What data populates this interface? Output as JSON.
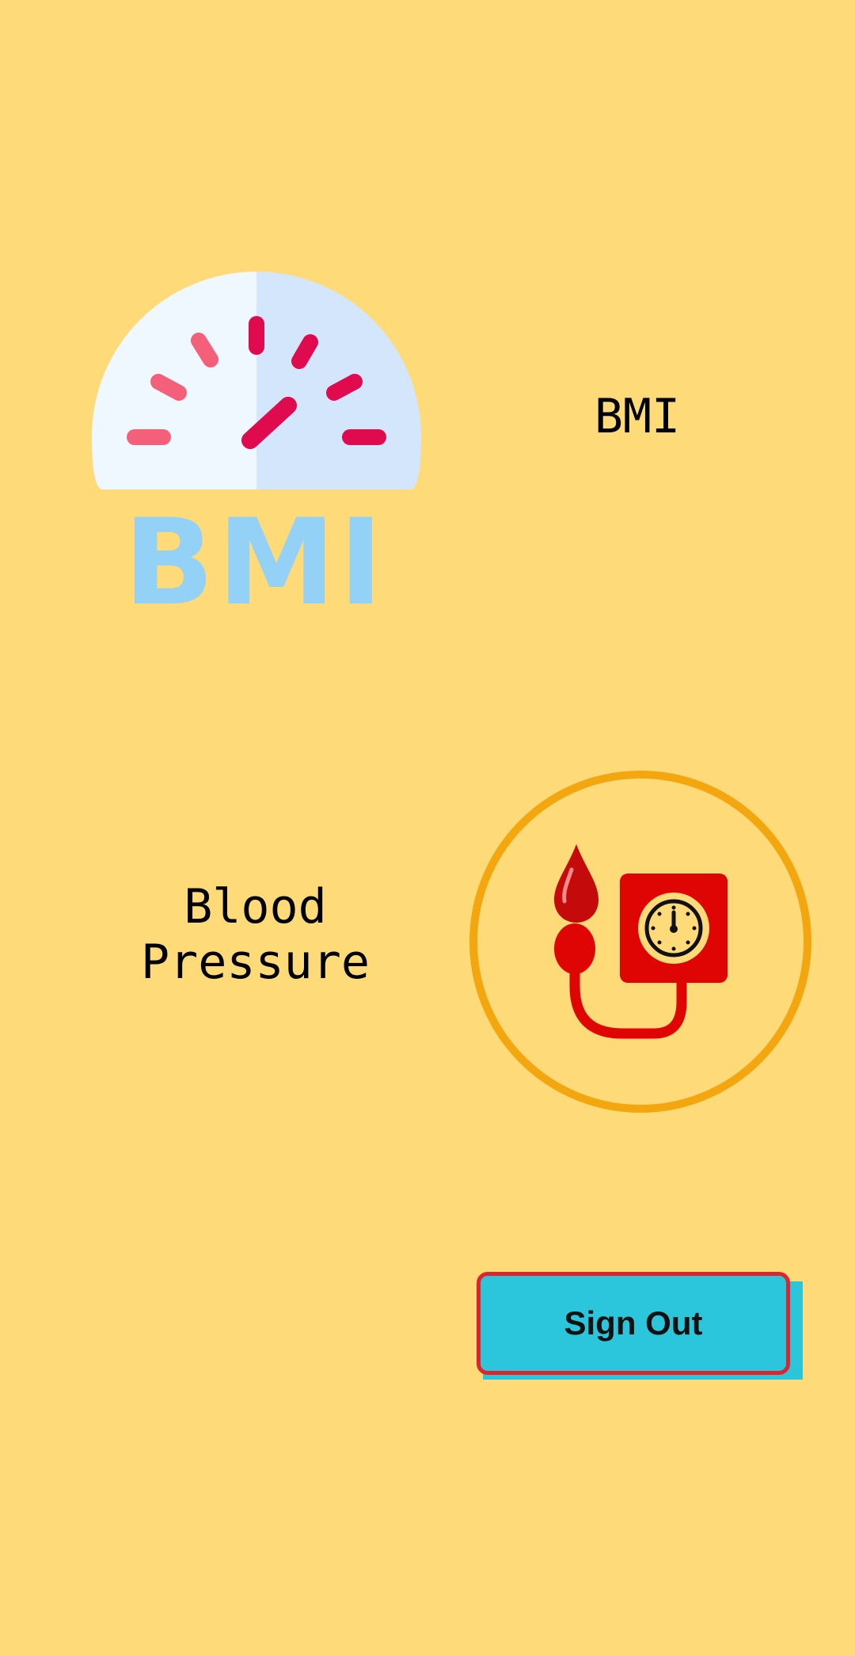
{
  "colors": {
    "background": "#FFDA79",
    "button_fill": "#2BC6DB",
    "button_border": "#E0242E",
    "ring": "#F4A60F",
    "gauge_left": "#EFF7FF",
    "gauge_right": "#D3E6FB",
    "tick_pink": "#F4607A",
    "tick_crimson": "#E00B4E",
    "bmi_letters": "#94D1F7",
    "device_red": "#E00505"
  },
  "bmi": {
    "icon": "bmi-gauge-icon",
    "icon_text": "BMI",
    "label": "BMI"
  },
  "blood_pressure": {
    "icon": "blood-pressure-monitor-icon",
    "label_line1": "Blood",
    "label_line2": "Pressure"
  },
  "sign_out": {
    "label": "Sign Out"
  }
}
